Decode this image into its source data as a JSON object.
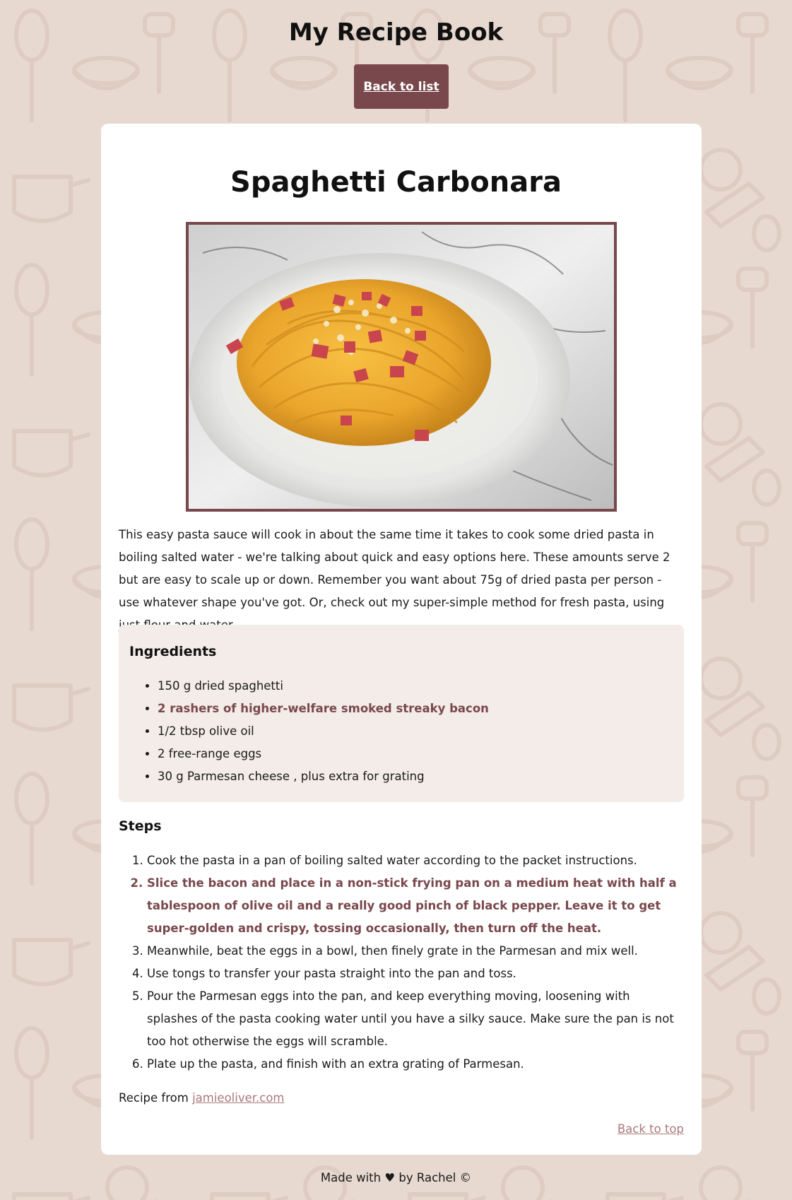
{
  "site": {
    "title": "My Recipe Book",
    "back_to_list": "Back to list"
  },
  "recipe": {
    "title": "Spaghetti Carbonara",
    "image_alt": "Plate of spaghetti carbonara with bacon and grated Parmesan",
    "description": "This easy pasta sauce will cook in about the same time it takes to cook some dried pasta in boiling salted water - we're talking about quick and easy options here. These amounts serve 2 but are easy to scale up or down. Remember you want about 75g of dried pasta per person - use whatever shape you've got. Or, check out my super-simple method for fresh pasta, using just flour and water.",
    "ingredients_heading": "Ingredients",
    "ingredients": [
      {
        "text": "150 g dried spaghetti",
        "highlighted": false
      },
      {
        "text": "2 rashers of higher-welfare smoked streaky bacon",
        "highlighted": true
      },
      {
        "text": "1/2 tbsp olive oil",
        "highlighted": false
      },
      {
        "text": "2 free-range eggs",
        "highlighted": false
      },
      {
        "text": "30 g Parmesan cheese , plus extra for grating",
        "highlighted": false
      }
    ],
    "steps_heading": "Steps",
    "steps": [
      {
        "text": "Cook the pasta in a pan of boiling salted water according to the packet instructions.",
        "highlighted": false
      },
      {
        "text": "Slice the bacon and place in a non-stick frying pan on a medium heat with half a tablespoon of olive oil and a really good pinch of black pepper. Leave it to get super-golden and crispy, tossing occasionally, then turn off the heat.",
        "highlighted": true
      },
      {
        "text": "Meanwhile, beat the eggs in a bowl, then finely grate in the Parmesan and mix well.",
        "highlighted": false
      },
      {
        "text": "Use tongs to transfer your pasta straight into the pan and toss.",
        "highlighted": false
      },
      {
        "text": "Pour the Parmesan eggs into the pan, and keep everything moving, loosening with splashes of the pasta cooking water until you have a silky sauce. Make sure the pan is not too hot otherwise the eggs will scramble.",
        "highlighted": false
      },
      {
        "text": "Plate up the pasta, and finish with an extra grating of Parmesan.",
        "highlighted": false
      }
    ],
    "source_prefix": "Recipe from",
    "source_link": "jamieoliver.com",
    "back_to_top": "Back to top"
  },
  "footer": {
    "text": "Made with ♥ by Rachel ©"
  },
  "colors": {
    "background": "#e8d9d0",
    "accent": "#79484c",
    "link": "#a8797d",
    "ingredients_panel": "#f3ece8"
  }
}
